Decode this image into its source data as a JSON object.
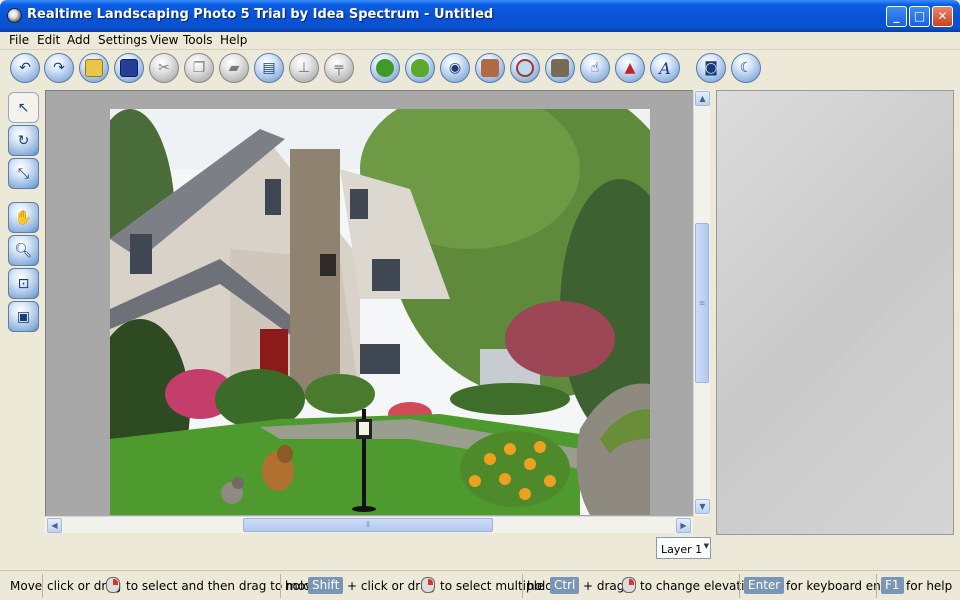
{
  "window": {
    "title": "Realtime Landscaping Photo 5 Trial by Idea Spectrum - Untitled",
    "minimize": "_",
    "maximize": "□",
    "close": "✕"
  },
  "menu": [
    "File",
    "Edit",
    "Add",
    "Settings",
    "View",
    "Tools",
    "Help"
  ],
  "toolbar": {
    "buttons": [
      {
        "icon": "undo-icon",
        "enabled": true
      },
      {
        "icon": "redo-icon",
        "enabled": true
      },
      {
        "icon": "open-folder-icon",
        "enabled": true
      },
      {
        "icon": "save-icon",
        "enabled": true
      },
      {
        "icon": "cut-icon",
        "enabled": false
      },
      {
        "icon": "copy-icon",
        "enabled": false
      },
      {
        "icon": "paste-icon",
        "enabled": false
      },
      {
        "icon": "print-icon",
        "enabled": true
      },
      {
        "icon": "flip-icon",
        "enabled": false
      },
      {
        "icon": "table-icon",
        "enabled": false
      },
      {
        "icon": "plants-icon",
        "enabled": true
      },
      {
        "icon": "shrub-icon",
        "enabled": true
      },
      {
        "icon": "camera-icon",
        "enabled": true
      },
      {
        "icon": "wall-icon",
        "enabled": true
      },
      {
        "icon": "pond-icon",
        "enabled": true
      },
      {
        "icon": "box-icon",
        "enabled": true
      },
      {
        "icon": "pointer-icon",
        "enabled": true
      },
      {
        "icon": "mountain-icon",
        "enabled": true
      },
      {
        "icon": "text-icon",
        "enabled": true
      },
      {
        "icon": "photo-camera-icon",
        "enabled": true
      },
      {
        "icon": "moon-icon",
        "enabled": true
      }
    ]
  },
  "left_tools": [
    {
      "icon": "select-arrow-icon",
      "selected": true
    },
    {
      "icon": "rotate-icon",
      "selected": false
    },
    {
      "icon": "resize-icon",
      "selected": false
    },
    {
      "icon": "pan-hand-icon",
      "selected": false
    },
    {
      "icon": "zoom-icon",
      "selected": false
    },
    {
      "icon": "zoom-fit-icon",
      "selected": false
    },
    {
      "icon": "zoom-window-icon",
      "selected": false
    }
  ],
  "layer": {
    "selected": "Layer 1"
  },
  "status": {
    "mode": "Move",
    "t1": "click or drag",
    "t2": "to select and then drag to move",
    "t3": "hold",
    "key_shift": "Shift",
    "t4": "+ click or drag",
    "t5": "to select multiple",
    "t6": "hold",
    "key_ctrl": "Ctrl",
    "t7": "+ drag",
    "t8": "to change elevation",
    "key_enter": "Enter",
    "t9": "for keyboard entry",
    "key_f1": "F1",
    "t10": "for help"
  },
  "colors": {
    "titlebar": "#0853d6",
    "menu": "#ece9d8",
    "canvas": "#a8a8a8"
  }
}
